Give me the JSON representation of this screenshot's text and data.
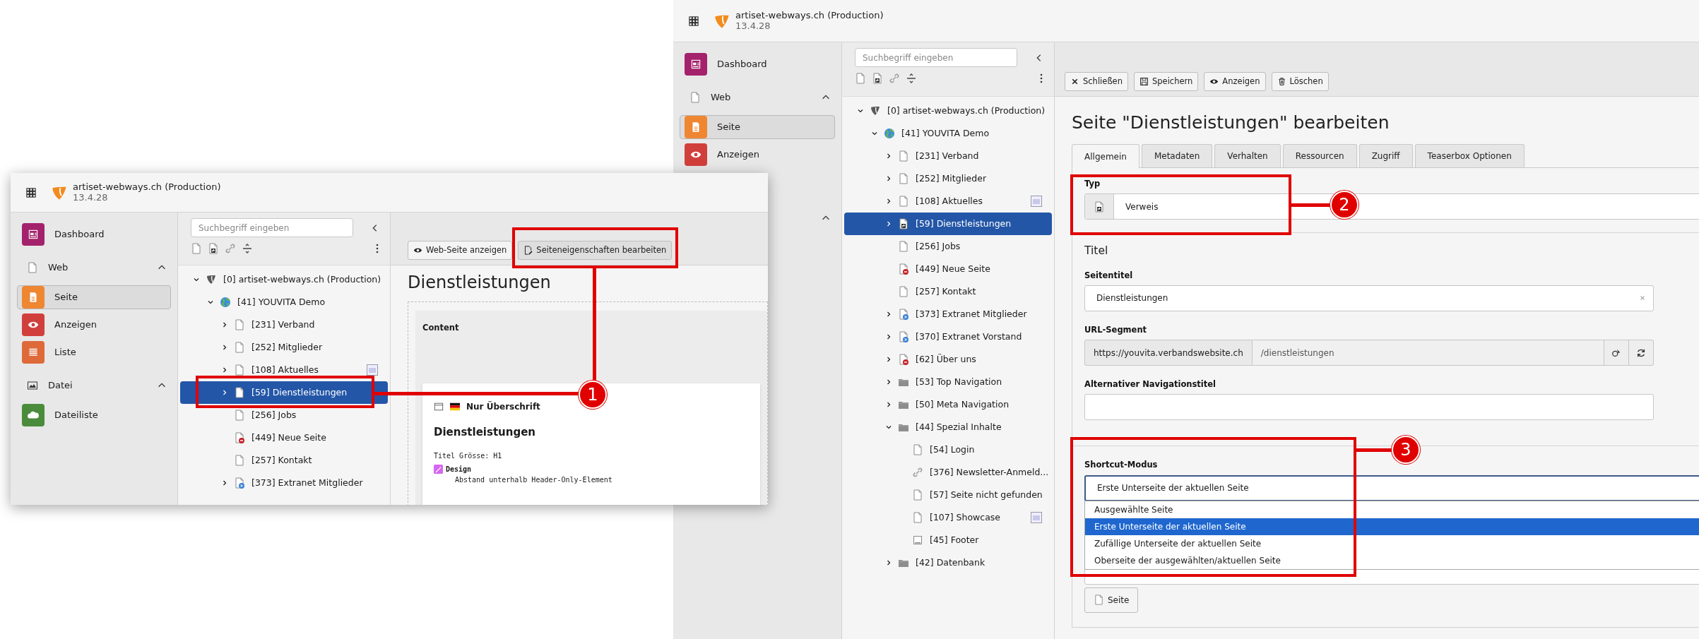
{
  "back_window": {
    "header": {
      "site": "artiset-webways.ch (Production)",
      "version": "13.4.28"
    },
    "sidebar": [
      {
        "kind": "dashboard",
        "label": "Dashboard",
        "selected": false
      },
      {
        "kind": "web-group",
        "label": "Web",
        "expanded": true
      },
      {
        "kind": "page-module",
        "label": "Seite",
        "selected": true
      },
      {
        "kind": "view-module",
        "label": "Anzeigen",
        "selected": false
      },
      {
        "kind": "covered-group",
        "expanded": true
      }
    ],
    "tree_search": {
      "placeholder": "Suchbegriff eingeben"
    },
    "tree": [
      {
        "kind": "root",
        "label": "[0] artiset-webways.ch (Production)",
        "expanded": true,
        "selected": false,
        "children": [
          {
            "kind": "site",
            "label": "[41] YOUVITA Demo",
            "expanded": true,
            "selected": false,
            "children": [
              {
                "kind": "page",
                "label": "[231] Verband",
                "expanded": false,
                "selected": false
              },
              {
                "kind": "page",
                "label": "[252] Mitglieder",
                "expanded": false,
                "selected": false
              },
              {
                "kind": "page",
                "label": "[108] Aktuelles",
                "expanded": false,
                "selected": false,
                "badge": true
              },
              {
                "kind": "shortcut",
                "label": "[59] Dienstleistungen",
                "expanded": false,
                "selected": true
              },
              {
                "kind": "page",
                "label": "[256] Jobs",
                "selected": false
              },
              {
                "kind": "hidden",
                "label": "[449] Neue Seite",
                "selected": false
              },
              {
                "kind": "page",
                "label": "[257] Kontakt",
                "selected": false
              },
              {
                "kind": "mountpoint",
                "label": "[373] Extranet Mitglieder",
                "expanded": false,
                "selected": false
              },
              {
                "kind": "mountpoint",
                "label": "[370] Extranet Vorstand",
                "expanded": false,
                "selected": false
              },
              {
                "kind": "hidden",
                "label": "[62] Über uns",
                "expanded": false,
                "selected": false
              },
              {
                "kind": "folder",
                "label": "[53] Top Navigation",
                "expanded": false,
                "selected": false
              },
              {
                "kind": "folder",
                "label": "[50] Meta Navigation",
                "expanded": false,
                "selected": false
              },
              {
                "kind": "folder",
                "label": "[44] Spezial Inhalte",
                "expanded": true,
                "selected": false,
                "children": [
                  {
                    "kind": "page",
                    "label": "[54] Login",
                    "selected": false
                  },
                  {
                    "kind": "link",
                    "label": "[376] Newsletter-Anmeld...",
                    "selected": false
                  },
                  {
                    "kind": "page",
                    "label": "[57] Seite nicht gefunden",
                    "selected": false
                  },
                  {
                    "kind": "page",
                    "label": "[107] Showcase",
                    "selected": false,
                    "badge": true
                  },
                  {
                    "kind": "footer",
                    "label": "[45] Footer",
                    "selected": false
                  }
                ]
              },
              {
                "kind": "folder",
                "label": "[42] Datenbank",
                "expanded": false,
                "selected": false
              }
            ]
          }
        ]
      }
    ],
    "toolbar": [
      {
        "kind": "close",
        "label": "Schließen"
      },
      {
        "kind": "save",
        "label": "Speichern"
      },
      {
        "kind": "view",
        "label": "Anzeigen"
      },
      {
        "kind": "delete",
        "label": "Löschen"
      }
    ],
    "title": "Seite \"Dienstleistungen\" bearbeiten",
    "tabs": [
      {
        "label": "Allgemein",
        "selected": true
      },
      {
        "label": "Metadaten",
        "selected": false
      },
      {
        "label": "Verhalten",
        "selected": false
      },
      {
        "label": "Ressourcen",
        "selected": false
      },
      {
        "label": "Zugriff",
        "selected": false
      },
      {
        "label": "Teaserbox Optionen",
        "selected": false
      }
    ],
    "type_field": {
      "label": "Typ",
      "value": "Verweis"
    },
    "section_title": "Titel",
    "page_title_field": {
      "label": "Seitentitel",
      "value": "Dienstleistungen"
    },
    "url_segment_field": {
      "label": "URL-Segment",
      "prefix": "https://youvita.verbandswebsite.ch",
      "value": "/dienstleistungen"
    },
    "nav_title_field": {
      "label": "Alternativer Navigationstitel"
    },
    "shortcut_mode_field": {
      "label": "Shortcut-Modus",
      "value": "Erste Unterseite der aktuellen Seite",
      "options": [
        {
          "label": "Ausgewählte Seite",
          "selected": false
        },
        {
          "label": "Erste Unterseite der aktuellen Seite",
          "selected": true
        },
        {
          "label": "Zufällige Unterseite der aktuellen Seite",
          "selected": false
        },
        {
          "label": "Oberseite der ausgewählten/aktuellen Seite",
          "selected": false
        }
      ]
    },
    "page_button": "Seite"
  },
  "front_window": {
    "header": {
      "site": "artiset-webways.ch (Production)",
      "version": "13.4.28"
    },
    "sidebar": [
      {
        "kind": "dashboard",
        "label": "Dashboard",
        "selected": false
      },
      {
        "kind": "web-group",
        "label": "Web",
        "expanded": true
      },
      {
        "kind": "page-module",
        "label": "Seite",
        "selected": true
      },
      {
        "kind": "view-module",
        "label": "Anzeigen",
        "selected": false
      },
      {
        "kind": "list-module",
        "label": "Liste",
        "selected": false
      },
      {
        "kind": "file-group",
        "label": "Datei",
        "expanded": true
      },
      {
        "kind": "file-module",
        "label": "Dateiliste",
        "selected": false
      }
    ],
    "tree_search": {
      "placeholder": "Suchbegriff eingeben"
    },
    "tree": [
      {
        "kind": "root",
        "label": "[0] artiset-webways.ch (Production)",
        "expanded": true,
        "selected": false,
        "children": [
          {
            "kind": "site",
            "label": "[41] YOUVITA Demo",
            "expanded": true,
            "selected": false,
            "children": [
              {
                "kind": "page",
                "label": "[231] Verband",
                "expanded": false,
                "selected": false
              },
              {
                "kind": "page",
                "label": "[252] Mitglieder",
                "expanded": false,
                "selected": false
              },
              {
                "kind": "page",
                "label": "[108] Aktuelles",
                "expanded": false,
                "selected": false,
                "badge": true
              },
              {
                "kind": "page",
                "label": "[59] Dienstleistungen",
                "expanded": false,
                "selected": true
              },
              {
                "kind": "page",
                "label": "[256] Jobs",
                "selected": false
              },
              {
                "kind": "hidden",
                "label": "[449] Neue Seite",
                "selected": false
              },
              {
                "kind": "page",
                "label": "[257] Kontakt",
                "selected": false
              },
              {
                "kind": "mountpoint",
                "label": "[373] Extranet Mitglieder",
                "expanded": false,
                "selected": false
              }
            ]
          }
        ]
      }
    ],
    "toolbar": [
      {
        "kind": "view",
        "label": "Web-Seite anzeigen"
      },
      {
        "kind": "edit",
        "label": "Seiteneigenschaften bearbeiten"
      }
    ],
    "title": "Dienstleistungen",
    "preview": {
      "column": "Content",
      "element_title": "Nur Überschrift",
      "headline": "Dienstleistungen",
      "meta": "Titel Grösse: H1",
      "design_label": "Design",
      "design_items": [
        "Abstand unterhalb Header-Only-Element"
      ]
    }
  },
  "annotations": [
    {
      "number": "1"
    },
    {
      "number": "2"
    },
    {
      "number": "3"
    }
  ]
}
